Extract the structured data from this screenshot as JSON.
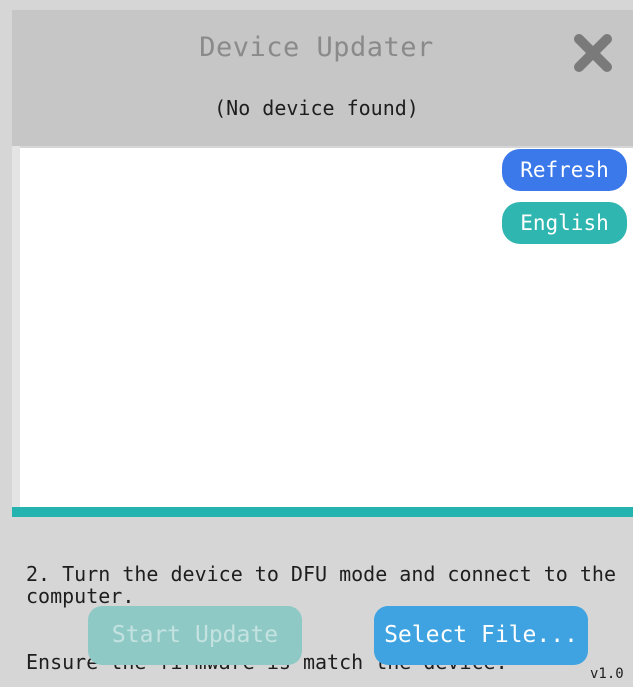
{
  "window": {
    "title": "Device Updater",
    "status": "(No device found)",
    "close_icon": "close-x-icon"
  },
  "actions": {
    "refresh_label": "Refresh",
    "language_label": "English"
  },
  "instructions": {
    "line1": "2. Turn the device to DFU mode and connect to the computer.",
    "line2": "Ensure the firmware is match the device."
  },
  "buttons": {
    "start_update": "Start Update",
    "select_file": "Select File..."
  },
  "footer": {
    "version": "v1.0"
  },
  "colors": {
    "refresh": "#3b78ea",
    "english": "#2fb6b0",
    "progress": "#24b3af",
    "start_update_disabled": "#8fc9c6",
    "select_file": "#3fa3e1"
  }
}
